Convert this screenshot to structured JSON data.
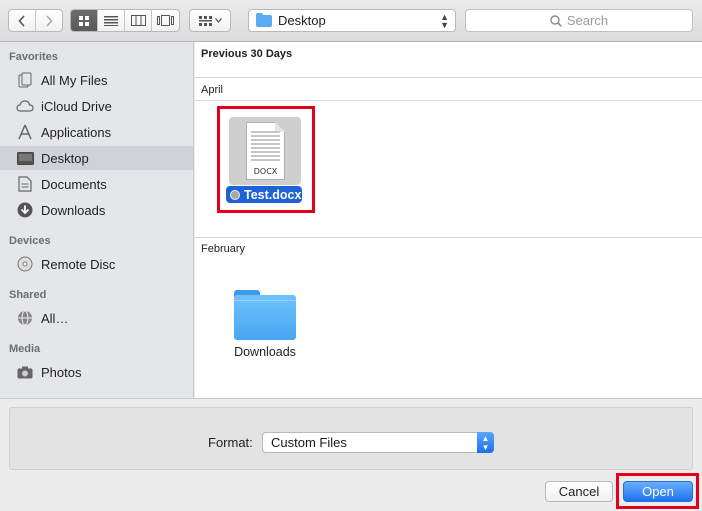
{
  "toolbar": {
    "back_icon": "chevron-left-icon",
    "forward_icon": "chevron-right-icon",
    "view_modes": [
      "icon-view-icon",
      "list-view-icon",
      "column-view-icon",
      "coverflow-view-icon"
    ],
    "arrange_icon": "arrange-grid-icon",
    "location": "Desktop",
    "search_placeholder": "Search"
  },
  "sidebar": {
    "sections": [
      {
        "title": "Favorites",
        "items": [
          {
            "label": "All My Files",
            "icon": "all-files-icon"
          },
          {
            "label": "iCloud Drive",
            "icon": "cloud-icon"
          },
          {
            "label": "Applications",
            "icon": "applications-icon"
          },
          {
            "label": "Desktop",
            "icon": "desktop-icon",
            "selected": true
          },
          {
            "label": "Documents",
            "icon": "documents-icon"
          },
          {
            "label": "Downloads",
            "icon": "download-icon"
          }
        ]
      },
      {
        "title": "Devices",
        "items": [
          {
            "label": "Remote Disc",
            "icon": "disc-icon"
          }
        ]
      },
      {
        "title": "Shared",
        "items": [
          {
            "label": "All…",
            "icon": "network-icon"
          }
        ]
      },
      {
        "title": "Media",
        "items": [
          {
            "label": "Photos",
            "icon": "camera-icon"
          }
        ]
      }
    ]
  },
  "main": {
    "header": "Previous 30 Days",
    "groups": [
      {
        "title": "April",
        "files": [
          {
            "name": "Test.docx",
            "type_label": "DOCX",
            "selected": true
          }
        ]
      },
      {
        "title": "February",
        "files": [
          {
            "name": "Downloads",
            "type": "folder"
          }
        ]
      }
    ]
  },
  "footer": {
    "format_label": "Format:",
    "format_value": "Custom Files",
    "cancel_label": "Cancel",
    "open_label": "Open"
  },
  "colors": {
    "selection": "#1e63d6",
    "accent_button": "#1f72f0",
    "annotation": "#e2001a",
    "folder": "#5aacf0"
  }
}
